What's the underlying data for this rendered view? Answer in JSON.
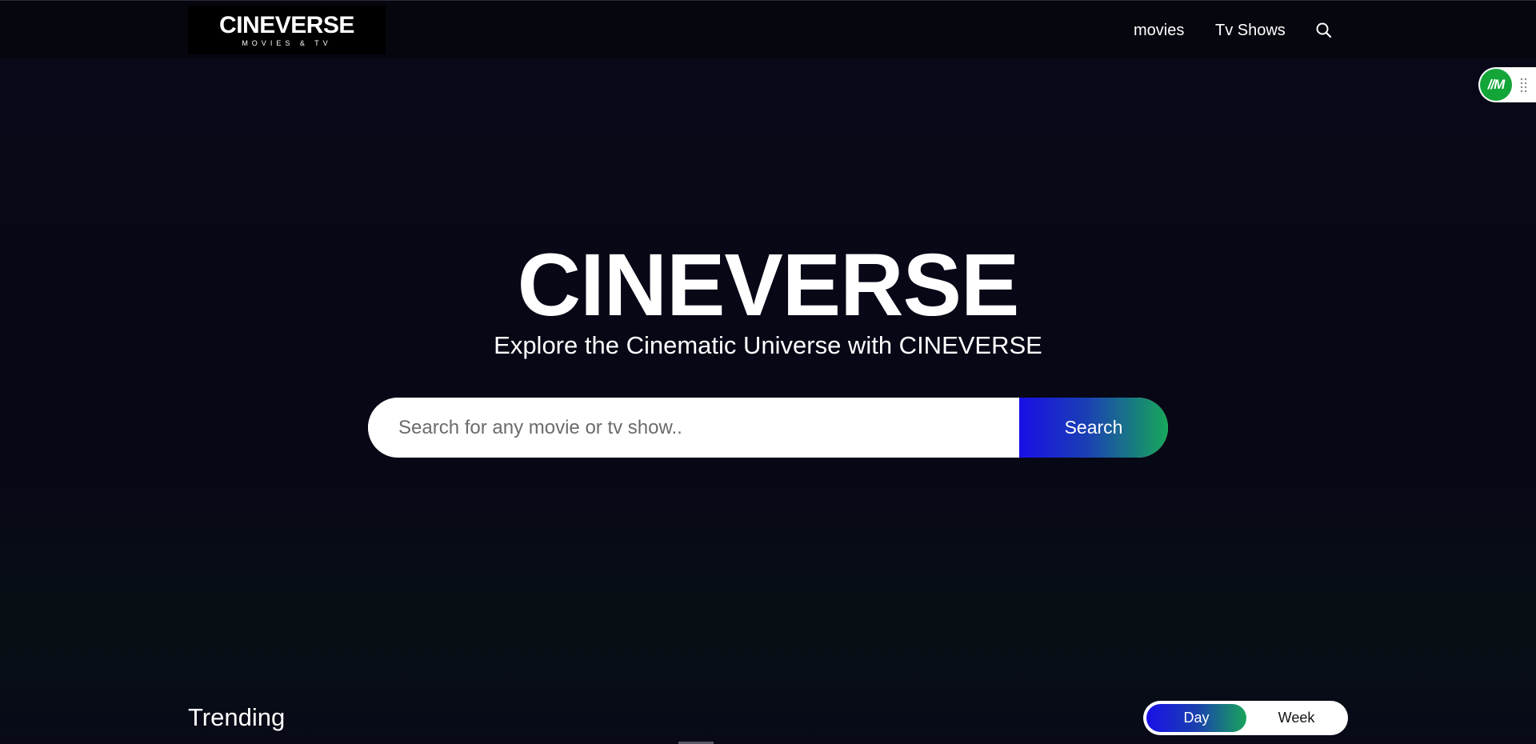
{
  "header": {
    "logo": {
      "title": "CINEVERSE",
      "subtitle": "MOVIES & TV"
    },
    "nav": {
      "movies_label": "movies",
      "tv_label": "Tv Shows",
      "search_icon": "search-icon"
    }
  },
  "extension_widget": {
    "badge_text": "//M",
    "icon": "drag-handle-icon",
    "color": "#13a538"
  },
  "hero": {
    "title": "CINEVERSE",
    "subtitle": "Explore the Cinematic Universe with CINEVERSE",
    "search": {
      "placeholder": "Search for any movie or tv show..",
      "value": "",
      "button_label": "Search"
    }
  },
  "trending": {
    "title": "Trending",
    "toggle": {
      "options": [
        "Day",
        "Week"
      ],
      "selected": "Day"
    }
  },
  "colors": {
    "background": "#07071a",
    "accent_start": "#1a0fe6",
    "accent_end": "#17a85a"
  }
}
